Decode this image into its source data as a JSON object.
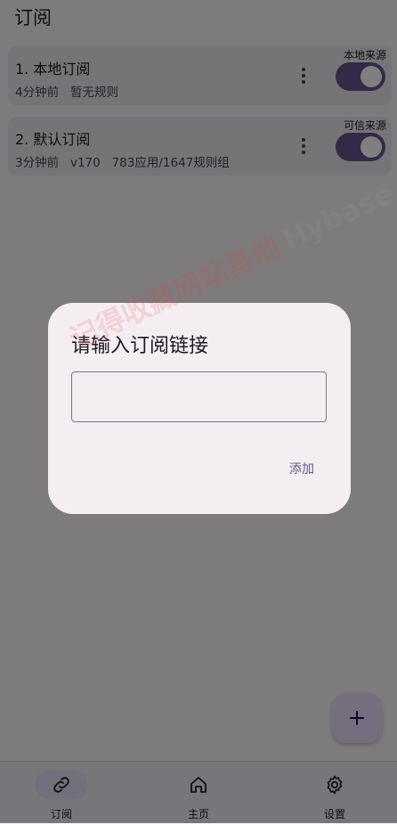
{
  "header": {
    "title": "订阅"
  },
  "subscriptions": [
    {
      "title": "1. 本地订阅",
      "meta": "4分钟前   暂无规则",
      "badge": "本地来源",
      "enabled": true
    },
    {
      "title": "2. 默认订阅",
      "meta": "3分钟前   v170   783应用/1647规则组",
      "badge": "可信来源",
      "enabled": true
    }
  ],
  "dialog": {
    "title": "请输入订阅链接",
    "input_value": "",
    "add_label": "添加"
  },
  "fab": {
    "icon": "plus-icon"
  },
  "nav": {
    "items": [
      {
        "label": "订阅",
        "icon": "link-icon",
        "active": true
      },
      {
        "label": "主页",
        "icon": "home-icon",
        "active": false
      },
      {
        "label": "设置",
        "icon": "gear-icon",
        "active": false
      }
    ]
  },
  "watermark": {
    "cn": "记得收藏网站基地",
    "en": "Hybase.com"
  },
  "colors": {
    "primary": "#65558f",
    "surface": "#fdf7fb",
    "card": "#efe8f0",
    "dialog": "#f4eef3",
    "fab": "#eaddff",
    "nav_active": "#e8def8"
  }
}
